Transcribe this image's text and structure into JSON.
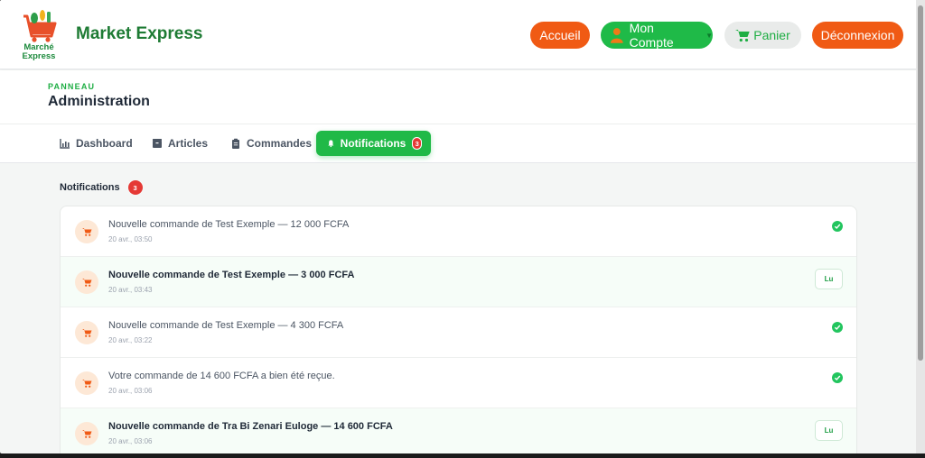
{
  "brand": {
    "name": "Market Express",
    "logo_text_line1": "Marché",
    "logo_text_line2": "Express"
  },
  "nav": {
    "accueil": "Accueil",
    "mon_compte": "Mon Compte",
    "panier": "Panier",
    "deconnexion": "Déconnexion"
  },
  "panel": {
    "kicker": "PANNEAU",
    "title": "Administration"
  },
  "tabs": [
    {
      "label": "Dashboard",
      "icon": "chart-icon"
    },
    {
      "label": "Articles",
      "icon": "box-icon"
    },
    {
      "label": "Commandes",
      "icon": "clipboard-icon"
    },
    {
      "label": "Notifications",
      "icon": "bell-icon",
      "badge": "3",
      "active": true
    }
  ],
  "notifications_section": {
    "title": "Notifications",
    "count": "3",
    "items": [
      {
        "message": "Nouvelle commande de Test Exemple — 12 000 FCFA",
        "time": "20 avr., 03:50",
        "read": true
      },
      {
        "message": "Nouvelle commande de Test Exemple — 3 000 FCFA",
        "time": "20 avr., 03:43",
        "read": false,
        "action": "Lu"
      },
      {
        "message": "Nouvelle commande de Test Exemple — 4 300 FCFA",
        "time": "20 avr., 03:22",
        "read": true
      },
      {
        "message": "Votre commande de 14 600 FCFA a bien été reçue.",
        "time": "20 avr., 03:06",
        "read": true
      },
      {
        "message": "Nouvelle commande de Tra Bi Zenari Euloge — 14 600 FCFA",
        "time": "20 avr., 03:06",
        "read": false,
        "action": "Lu"
      }
    ]
  },
  "colors": {
    "brand_green": "#1e7b34",
    "accent_green": "#20b947",
    "accent_orange": "#f05a14",
    "badge_red": "#e53935"
  }
}
